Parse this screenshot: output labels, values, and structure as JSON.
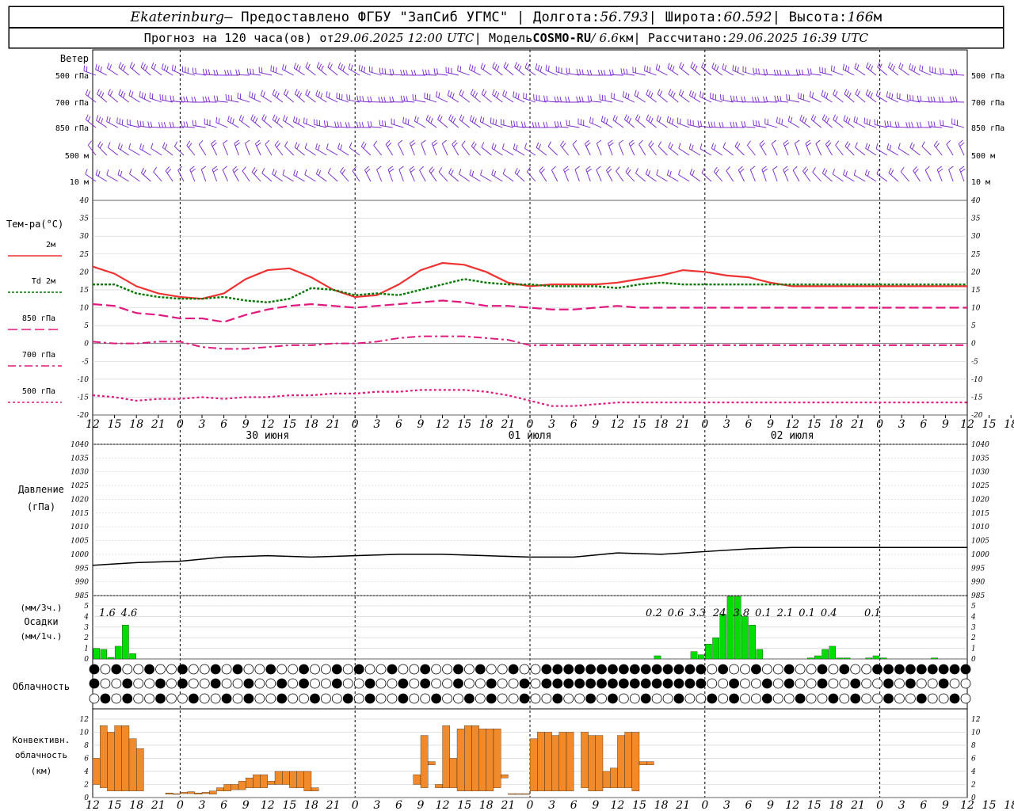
{
  "header": {
    "line1": {
      "city": "Ekaterinburg",
      "provider": " — Предоставлено ФГБУ \"ЗапСиб УГМС\" | Долгота: ",
      "lon": "56.793",
      "lat_label": " | Широта: ",
      "lat": "60.592",
      "alt_label": " | Высота: ",
      "alt": "166",
      "alt_unit": "м"
    },
    "line2": {
      "forecast": "Прогноз на 120 часа(ов) от ",
      "issued": "29.06.2025 12:00 UTC",
      "model_label": " | Модель ",
      "model": "COSMO-RU",
      "res": " / 6.6",
      "res_unit": "км",
      "calc_label": " | Рассчитано: ",
      "calc": "29.06.2025 16:39 UTC"
    }
  },
  "labels": {
    "wind": "Ветер",
    "wind_levels": [
      "500 гПа",
      "700 гПа",
      "850 гПа",
      "500 м",
      "10 м"
    ],
    "temp_title": "Тем-ра(°C)",
    "temp_legend": [
      "2м",
      "Td  2м",
      "850 гПа",
      "700 гПа",
      "500 гПа"
    ],
    "pressure_title": "Давление",
    "pressure_unit": "(гПа)",
    "precip_unit3": "(мм/3ч.)",
    "precip_title": "Осадки",
    "precip_unit1": "(мм/1ч.)",
    "cloud_title": "Облачность",
    "conv_title1": "Конвективн.",
    "conv_title2": "облачность",
    "conv_unit": "(км)"
  },
  "colors": {
    "t2m": "#ee3333",
    "td2m": "#007700",
    "t850": "#e0197f",
    "t700": "#e0197f",
    "t500": "#e0197f",
    "wind": "#7722cc",
    "precip": "#00dd00",
    "conv": "#f08a2a",
    "pressure": "#000000"
  },
  "chart_data": [
    {
      "type": "line",
      "name": "temperature",
      "x_hours": [
        0,
        3,
        6,
        9,
        12,
        15,
        18,
        21,
        24,
        27,
        30,
        33,
        36,
        39,
        42,
        45,
        48,
        51,
        54,
        57,
        60,
        63,
        66,
        69,
        72,
        75,
        78,
        81,
        84,
        87,
        90,
        93,
        96,
        99,
        102,
        105,
        108,
        111,
        114,
        117,
        120
      ],
      "x_tick_labels": [
        "12",
        "15",
        "18",
        "21",
        "0",
        "3",
        "6",
        "9",
        "12",
        "15",
        "18",
        "21",
        "0",
        "3",
        "6",
        "9",
        "12",
        "15",
        "18",
        "21",
        "0",
        "3",
        "6",
        "9",
        "12",
        "15",
        "18",
        "21",
        "0",
        "3",
        "6",
        "9",
        "12",
        "15",
        "18",
        "21",
        "0",
        "3",
        "6",
        "9",
        "12",
        "15",
        "18"
      ],
      "date_labels": [
        "30 июня",
        "01 июля",
        "02 июля"
      ],
      "ylim": [
        -20,
        40
      ],
      "y_ticks": [
        -20,
        -15,
        -10,
        -5,
        0,
        5,
        10,
        15,
        20,
        25,
        30,
        35,
        40
      ],
      "series": [
        {
          "name": "2м",
          "values": [
            21.5,
            19.5,
            16,
            14,
            13,
            12.5,
            14,
            18,
            20.5,
            21,
            18.5,
            15,
            13,
            13.5,
            16.5,
            20.5,
            22.5,
            22,
            20,
            17,
            16,
            16.5,
            16.5,
            16.5,
            17,
            18,
            19,
            20.5,
            20,
            19,
            18.5,
            17,
            16,
            16,
            16,
            16,
            16,
            16,
            16,
            16,
            16
          ]
        },
        {
          "name": "Td  2м",
          "values": [
            16.5,
            16.5,
            14,
            13,
            12.5,
            12.5,
            13,
            12,
            11.5,
            12.5,
            15.5,
            15,
            13.5,
            14,
            13.5,
            15,
            16.5,
            18,
            17,
            16.5,
            16.5,
            16,
            16,
            16,
            15.5,
            16.5,
            17,
            16.5,
            16.5,
            16.5,
            16.5,
            16.5,
            16.5,
            16.5,
            16.5,
            16.5,
            16.5,
            16.5,
            16.5,
            16.5,
            16.5
          ]
        },
        {
          "name": "850 гПа",
          "values": [
            11,
            10.5,
            8.5,
            8,
            7,
            7,
            6,
            8,
            9.5,
            10.5,
            11,
            10.5,
            10,
            10.5,
            11,
            11.5,
            12,
            11.5,
            10.5,
            10.5,
            10,
            9.5,
            9.5,
            10,
            10.5,
            10,
            10,
            10,
            10,
            10,
            10,
            10,
            10,
            10,
            10,
            10,
            10,
            10,
            10,
            10,
            10
          ]
        },
        {
          "name": "700 гПа",
          "values": [
            0.5,
            0,
            0,
            0.5,
            0.5,
            -1,
            -1.5,
            -1.5,
            -1,
            -0.5,
            -0.5,
            0,
            0,
            0.5,
            1.5,
            2,
            2,
            2,
            1.5,
            1,
            -0.5,
            -0.5,
            -0.5,
            -0.5,
            -0.5,
            -0.5,
            -0.5,
            -0.5,
            -0.5,
            -0.5,
            -0.5,
            -0.5,
            -0.5,
            -0.5,
            -0.5,
            -0.5,
            -0.5,
            -0.5,
            -0.5,
            -0.5,
            -0.5
          ]
        },
        {
          "name": "500 гПа",
          "values": [
            -14.5,
            -15,
            -16,
            -15.5,
            -15.5,
            -15,
            -15.5,
            -15,
            -15,
            -14.5,
            -14.5,
            -14,
            -14,
            -13.5,
            -13.5,
            -13,
            -13,
            -13,
            -13.5,
            -14.5,
            -16,
            -17.5,
            -17.5,
            -17,
            -16.5,
            -16.5,
            -16.5,
            -16.5,
            -16.5,
            -16.5,
            -16.5,
            -16.5,
            -16.5,
            -16.5,
            -16.5,
            -16.5,
            -16.5,
            -16.5,
            -16.5,
            -16.5,
            -16.5
          ]
        }
      ]
    },
    {
      "type": "line",
      "name": "pressure",
      "x_hours": [
        0,
        6,
        12,
        18,
        24,
        30,
        36,
        42,
        48,
        54,
        60,
        66,
        72,
        78,
        84,
        90,
        96,
        102,
        108,
        114,
        120
      ],
      "values": [
        996,
        997,
        997.5,
        999,
        999.5,
        999,
        999.5,
        1000,
        1000,
        999.5,
        999,
        999,
        1000.5,
        1000,
        1001,
        1002,
        1002.5,
        1002.5,
        1002.5,
        1002.5,
        1002.5
      ],
      "ylim": [
        985,
        1040
      ],
      "y_ticks": [
        985,
        990,
        995,
        1000,
        1005,
        1010,
        1015,
        1020,
        1025,
        1030,
        1035,
        1040
      ]
    },
    {
      "type": "bar",
      "name": "precipitation",
      "ylim": [
        0,
        5
      ],
      "y_ticks": [
        0,
        1,
        2,
        3,
        4,
        5
      ],
      "hourly_mm": [
        1,
        0.9,
        0.15,
        1.2,
        3.2,
        0.5,
        0,
        0,
        0,
        0,
        0,
        0,
        0,
        0,
        0,
        0,
        0,
        0,
        0,
        0,
        0,
        0,
        0,
        0,
        0,
        0,
        0,
        0,
        0,
        0,
        0,
        0,
        0,
        0,
        0,
        0,
        0,
        0,
        0,
        0,
        0,
        0,
        0,
        0,
        0,
        0,
        0,
        0,
        0,
        0,
        0,
        0,
        0,
        0,
        0,
        0,
        0,
        0,
        0,
        0,
        0,
        0,
        0,
        0,
        0,
        0,
        0,
        0,
        0,
        0,
        0,
        0,
        0,
        0,
        0,
        0,
        0,
        0.3,
        0,
        0,
        0,
        0,
        0.7,
        0.4,
        1.4,
        2,
        4.2,
        6,
        6,
        4,
        3.2,
        0.9,
        0,
        0,
        0,
        0,
        0,
        0,
        0.1,
        0.3,
        0.9,
        1.2,
        0.1,
        0.1,
        0,
        0,
        0.1,
        0.3,
        0.1,
        0,
        0,
        0,
        0,
        0,
        0,
        0.1,
        0,
        0,
        0,
        0,
        0,
        0
      ],
      "totals_3h": [
        {
          "hour": 2,
          "label": "1.6"
        },
        {
          "hour": 5,
          "label": "4.6"
        },
        {
          "hour": 77,
          "label": "0.2"
        },
        {
          "hour": 80,
          "label": "0.6"
        },
        {
          "hour": 83,
          "label": "3.3"
        },
        {
          "hour": 86,
          "label": "24"
        },
        {
          "hour": 89,
          "label": "3.8"
        },
        {
          "hour": 92,
          "label": "0.1"
        },
        {
          "hour": 95,
          "label": "2.1"
        },
        {
          "hour": 98,
          "label": "0.1"
        },
        {
          "hour": 101,
          "label": "0.4"
        },
        {
          "hour": 107,
          "label": "0.1"
        }
      ]
    },
    {
      "type": "bar",
      "name": "convective_cloud",
      "ylim": [
        0,
        13
      ],
      "y_ticks": [
        0,
        2,
        4,
        6,
        8,
        10,
        12
      ],
      "segments_km": [
        {
          "h0": 0,
          "h1": 1,
          "base": 2,
          "top": 6
        },
        {
          "h0": 1,
          "h1": 2,
          "base": 1.5,
          "top": 11
        },
        {
          "h0": 2,
          "h1": 3,
          "base": 1,
          "top": 10
        },
        {
          "h0": 3,
          "h1": 4,
          "base": 1,
          "top": 11
        },
        {
          "h0": 4,
          "h1": 5,
          "base": 1,
          "top": 11
        },
        {
          "h0": 5,
          "h1": 6,
          "base": 1,
          "top": 9
        },
        {
          "h0": 6,
          "h1": 7,
          "base": 1,
          "top": 7.5
        },
        {
          "h0": 10,
          "h1": 11,
          "base": 0.5,
          "top": 0.7
        },
        {
          "h0": 11,
          "h1": 12,
          "base": 0.5,
          "top": 0.6
        },
        {
          "h0": 12,
          "h1": 13,
          "base": 0.6,
          "top": 0.8
        },
        {
          "h0": 13,
          "h1": 14,
          "base": 0.6,
          "top": 0.9
        },
        {
          "h0": 14,
          "h1": 15,
          "base": 0.5,
          "top": 0.7
        },
        {
          "h0": 15,
          "h1": 16,
          "base": 0.6,
          "top": 0.8
        },
        {
          "h0": 16,
          "h1": 17,
          "base": 0.5,
          "top": 1
        },
        {
          "h0": 17,
          "h1": 18,
          "base": 1,
          "top": 1.5
        },
        {
          "h0": 18,
          "h1": 19,
          "base": 1,
          "top": 2
        },
        {
          "h0": 19,
          "h1": 20,
          "base": 1.2,
          "top": 2
        },
        {
          "h0": 20,
          "h1": 21,
          "base": 1.2,
          "top": 2.5
        },
        {
          "h0": 21,
          "h1": 22,
          "base": 1.5,
          "top": 3
        },
        {
          "h0": 22,
          "h1": 23,
          "base": 1.5,
          "top": 3.5
        },
        {
          "h0": 23,
          "h1": 24,
          "base": 1.5,
          "top": 3.5
        },
        {
          "h0": 24,
          "h1": 25,
          "base": 2,
          "top": 2.5
        },
        {
          "h0": 25,
          "h1": 26,
          "base": 2,
          "top": 4
        },
        {
          "h0": 26,
          "h1": 27,
          "base": 2,
          "top": 4
        },
        {
          "h0": 27,
          "h1": 28,
          "base": 1.5,
          "top": 4
        },
        {
          "h0": 28,
          "h1": 29,
          "base": 1.5,
          "top": 4
        },
        {
          "h0": 29,
          "h1": 30,
          "base": 1,
          "top": 4
        },
        {
          "h0": 30,
          "h1": 31,
          "base": 1,
          "top": 1.5
        },
        {
          "h0": 44,
          "h1": 45,
          "base": 2,
          "top": 3.5
        },
        {
          "h0": 45,
          "h1": 46,
          "base": 1.5,
          "top": 9.5
        },
        {
          "h0": 46,
          "h1": 47,
          "base": 5,
          "top": 5.5
        },
        {
          "h0": 47,
          "h1": 48,
          "base": 1.5,
          "top": 2
        },
        {
          "h0": 48,
          "h1": 49,
          "base": 1.5,
          "top": 11
        },
        {
          "h0": 49,
          "h1": 50,
          "base": 1.5,
          "top": 6
        },
        {
          "h0": 50,
          "h1": 51,
          "base": 1,
          "top": 10.5
        },
        {
          "h0": 51,
          "h1": 52,
          "base": 1,
          "top": 11
        },
        {
          "h0": 52,
          "h1": 53,
          "base": 1,
          "top": 11
        },
        {
          "h0": 53,
          "h1": 54,
          "base": 1,
          "top": 10.5
        },
        {
          "h0": 54,
          "h1": 55,
          "base": 1,
          "top": 10.5
        },
        {
          "h0": 55,
          "h1": 56,
          "base": 1.5,
          "top": 10.5
        },
        {
          "h0": 56,
          "h1": 57,
          "base": 3,
          "top": 3.5
        },
        {
          "h0": 57,
          "h1": 58,
          "base": 0.5,
          "top": 0.6
        },
        {
          "h0": 58,
          "h1": 59,
          "base": 0.5,
          "top": 0.6
        },
        {
          "h0": 59,
          "h1": 60,
          "base": 0.5,
          "top": 0.6
        },
        {
          "h0": 60,
          "h1": 61,
          "base": 1,
          "top": 9
        },
        {
          "h0": 61,
          "h1": 62,
          "base": 1,
          "top": 10
        },
        {
          "h0": 62,
          "h1": 63,
          "base": 1,
          "top": 10
        },
        {
          "h0": 63,
          "h1": 64,
          "base": 1,
          "top": 9.5
        },
        {
          "h0": 64,
          "h1": 65,
          "base": 1,
          "top": 10
        },
        {
          "h0": 65,
          "h1": 66,
          "base": 1,
          "top": 10
        },
        {
          "h0": 67,
          "h1": 68,
          "base": 1.5,
          "top": 10
        },
        {
          "h0": 68,
          "h1": 69,
          "base": 1,
          "top": 9.5
        },
        {
          "h0": 69,
          "h1": 70,
          "base": 1,
          "top": 9.5
        },
        {
          "h0": 70,
          "h1": 71,
          "base": 1.5,
          "top": 4
        },
        {
          "h0": 71,
          "h1": 72,
          "base": 1.5,
          "top": 4.5
        },
        {
          "h0": 72,
          "h1": 73,
          "base": 1.5,
          "top": 9.5
        },
        {
          "h0": 73,
          "h1": 74,
          "base": 1.5,
          "top": 10
        },
        {
          "h0": 74,
          "h1": 75,
          "base": 1,
          "top": 10
        },
        {
          "h0": 75,
          "h1": 76,
          "base": 5,
          "top": 5.5
        },
        {
          "h0": 76,
          "h1": 77,
          "base": 5,
          "top": 5.5
        }
      ]
    }
  ]
}
